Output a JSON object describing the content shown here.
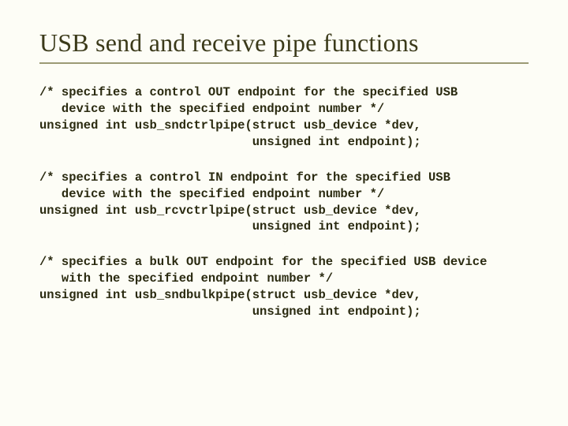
{
  "title": "USB send and receive pipe functions",
  "blocks": [
    "/* specifies a control OUT endpoint for the specified USB\n   device with the specified endpoint number */\nunsigned int usb_sndctrlpipe(struct usb_device *dev,\n                             unsigned int endpoint);",
    "/* specifies a control IN endpoint for the specified USB\n   device with the specified endpoint number */\nunsigned int usb_rcvctrlpipe(struct usb_device *dev,\n                             unsigned int endpoint);",
    "/* specifies a bulk OUT endpoint for the specified USB device\n   with the specified endpoint number */\nunsigned int usb_sndbulkpipe(struct usb_device *dev,\n                             unsigned int endpoint);"
  ]
}
